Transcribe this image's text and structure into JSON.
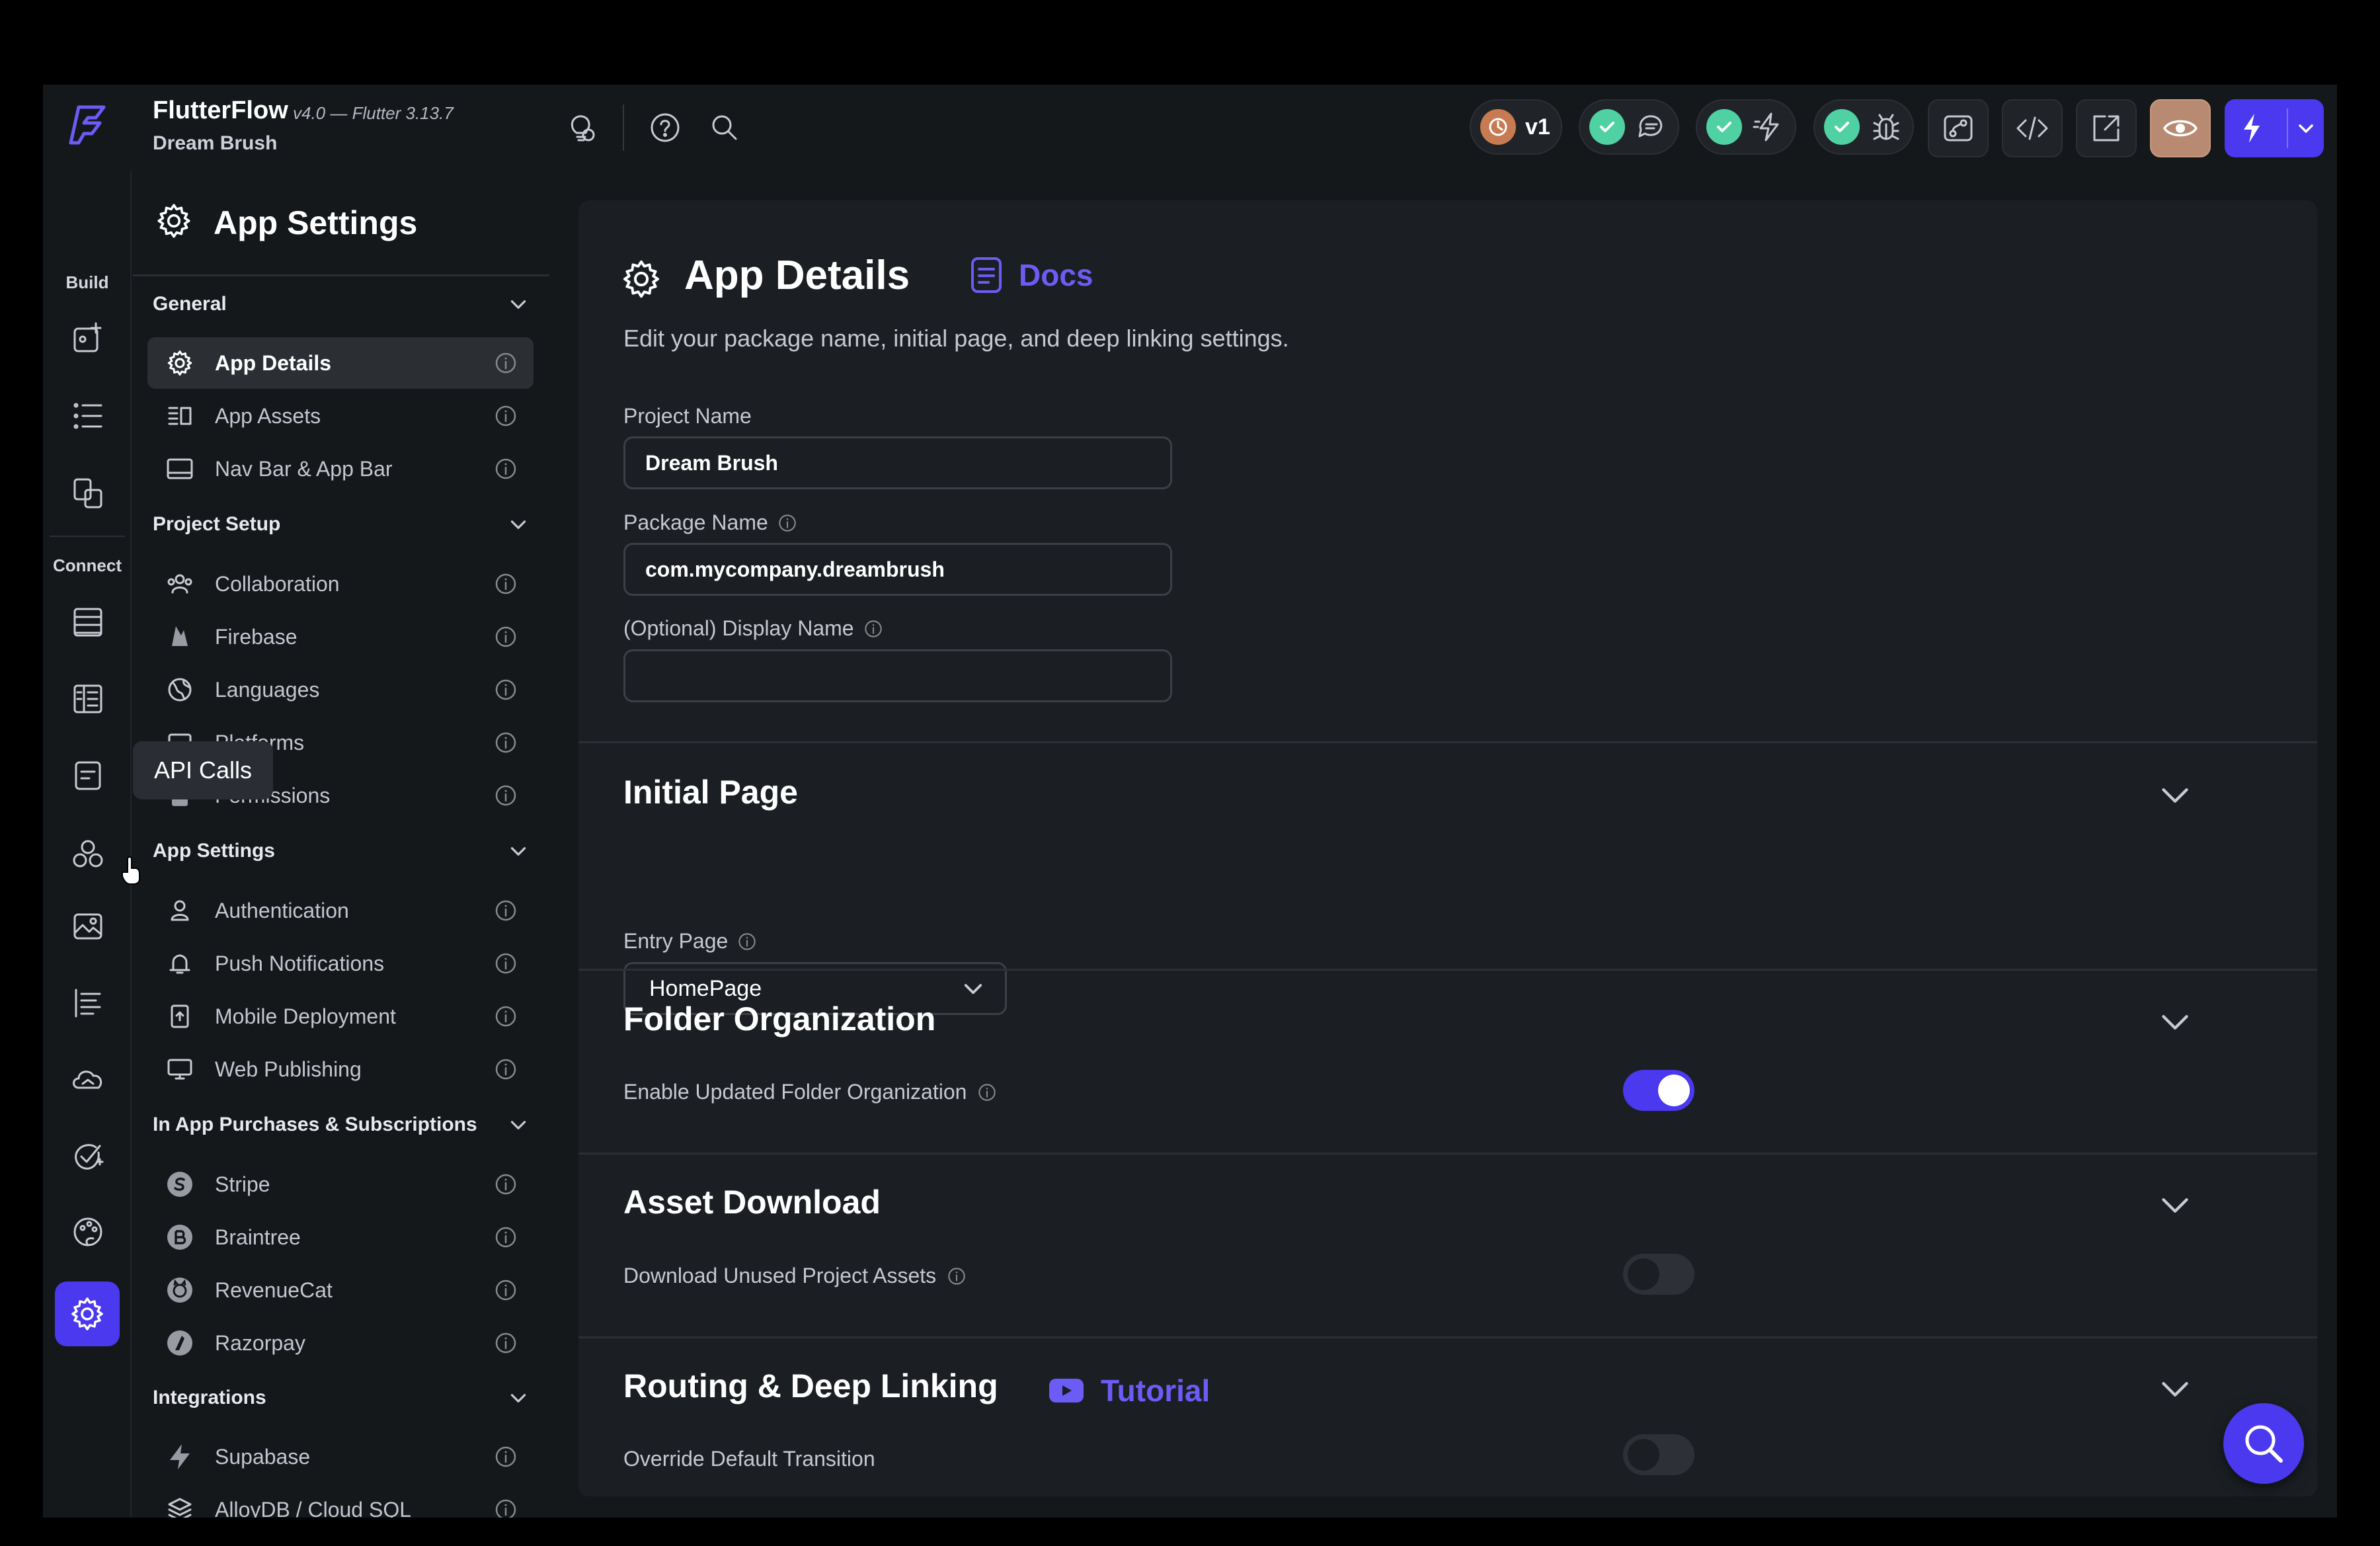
{
  "topbar": {
    "app_name": "FlutterFlow",
    "version_text": "v4.0 — Flutter 3.13.7",
    "project_name": "Dream Brush",
    "branch_label": "v1",
    "icons": [
      "flutterflow-logo-icon",
      "lightbulb-icon",
      "help-icon",
      "search-icon",
      "comments-icon",
      "lightning-icon",
      "bug-icon",
      "branch-icon",
      "code-icon",
      "open-external-icon",
      "eye-icon",
      "run-lightning-icon",
      "chevron-down-icon"
    ]
  },
  "rail": {
    "build_label": "Build",
    "connect_label": "Connect",
    "tooltip": "API Calls"
  },
  "sidebar": {
    "title": "App Settings",
    "groups": [
      {
        "title": "General",
        "items": [
          "App Details",
          "App Assets",
          "Nav Bar & App Bar"
        ]
      },
      {
        "title": "Project Setup",
        "items": [
          "Collaboration",
          "Firebase",
          "Languages",
          "Platforms",
          "Permissions"
        ]
      },
      {
        "title": "App Settings",
        "items": [
          "Authentication",
          "Push Notifications",
          "Mobile Deployment",
          "Web Publishing"
        ]
      },
      {
        "title": "In App Purchases & Subscriptions",
        "items": [
          "Stripe",
          "Braintree",
          "RevenueCat",
          "Razorpay"
        ]
      },
      {
        "title": "Integrations",
        "items": [
          "Supabase",
          "AlloyDB / Cloud SQL"
        ]
      }
    ],
    "active_item": "App Details"
  },
  "main": {
    "title": "App Details",
    "docs_label": "Docs",
    "description": "Edit your package name, initial page, and deep linking settings.",
    "project_name_label": "Project Name",
    "project_name_value": "Dream Brush",
    "package_name_label": "Package Name",
    "package_name_value": "com.mycompany.dreambrush",
    "display_name_label": "(Optional) Display Name",
    "display_name_value": "",
    "initial_page": {
      "title": "Initial Page",
      "entry_page_label": "Entry Page",
      "entry_page_value": "HomePage"
    },
    "folder_org": {
      "title": "Folder Organization",
      "toggle_label": "Enable Updated Folder Organization",
      "enabled": true
    },
    "asset_download": {
      "title": "Asset Download",
      "toggle_label": "Download Unused Project Assets",
      "enabled": false
    },
    "routing": {
      "title": "Routing & Deep Linking",
      "tutorial_label": "Tutorial",
      "toggle_label": "Override Default Transition",
      "enabled": false
    }
  },
  "colors": {
    "accent": "#4b39ef",
    "link": "#6b5cf6",
    "success": "#4fd1a4",
    "background": "#14181b",
    "panel": "#1b1f23"
  }
}
